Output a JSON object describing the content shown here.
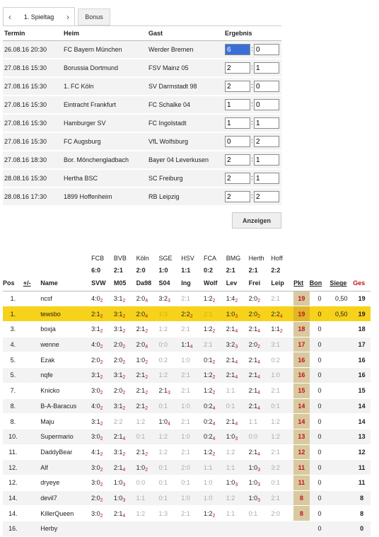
{
  "nav": {
    "prev_icon": "chevron-left-icon",
    "next_icon": "chevron-right-icon",
    "matchday_label": "1. Spieltag",
    "bonus_tab": "Bonus"
  },
  "fixtures": {
    "headers": {
      "date": "Termin",
      "home": "Heim",
      "guest": "Gast",
      "result": "Ergebnis"
    },
    "separator": ":",
    "rows": [
      {
        "date": "26.08.16 20:30",
        "home": "FC Bayern München",
        "guest": "Werder Bremen",
        "h": "6",
        "g": "0"
      },
      {
        "date": "27.08.16 15:30",
        "home": "Borussia Dortmund",
        "guest": "FSV Mainz 05",
        "h": "2",
        "g": "1"
      },
      {
        "date": "27.08.16 15:30",
        "home": "1. FC Köln",
        "guest": "SV Darmstadt 98",
        "h": "2",
        "g": "0"
      },
      {
        "date": "27.08.16 15:30",
        "home": "Eintracht Frankfurt",
        "guest": "FC Schalke 04",
        "h": "1",
        "g": "0"
      },
      {
        "date": "27.08.16 15:30",
        "home": "Hamburger SV",
        "guest": "FC Ingolstadt",
        "h": "1",
        "g": "1"
      },
      {
        "date": "27.08.16 15:30",
        "home": "FC Augsburg",
        "guest": "VfL Wolfsburg",
        "h": "0",
        "g": "2"
      },
      {
        "date": "27.08.16 18:30",
        "home": "Bor. Mönchengladbach",
        "guest": "Bayer 04 Leverkusen",
        "h": "2",
        "g": "1"
      },
      {
        "date": "28.08.16 15:30",
        "home": "Hertha BSC",
        "guest": "SC Freiburg",
        "h": "2",
        "g": "1"
      },
      {
        "date": "28.08.16 17:30",
        "home": "1899 Hoffenheim",
        "guest": "RB Leipzig",
        "h": "2",
        "g": "2"
      }
    ],
    "show_button": "Anzeigen"
  },
  "standings": {
    "game_headers": [
      "FCB",
      "BVB",
      "Köln",
      "SGE",
      "HSV",
      "FCA",
      "BMG",
      "Herth",
      "Hoff"
    ],
    "game_results": [
      "6:0",
      "2:1",
      "2:0",
      "1:0",
      "1:1",
      "0:2",
      "2:1",
      "2:1",
      "2:2"
    ],
    "guest_abbr": [
      "SVW",
      "M05",
      "Da98",
      "S04",
      "Ing",
      "Wolf",
      "Lev",
      "Frei",
      "Leip"
    ],
    "col_pos": "Pos",
    "col_pm": "+/-",
    "col_name": "Name",
    "col_pkt": "Pkt",
    "col_bon": "Bon",
    "col_sie": "Siege",
    "col_ges": "Ges",
    "rows": [
      {
        "pos": "1.",
        "name": "ncsf",
        "tips": [
          [
            "4:0",
            "2"
          ],
          [
            "3:1",
            "2"
          ],
          [
            "2:0",
            "4"
          ],
          [
            "3:2",
            "3"
          ],
          [
            "2:1",
            ""
          ],
          [
            "1:2",
            "2"
          ],
          [
            "1:4",
            "2"
          ],
          [
            "2:0",
            "2"
          ],
          [
            "2:1",
            ""
          ]
        ],
        "pkt": "19",
        "bon": "0",
        "sie": "0,50",
        "ges": "19"
      },
      {
        "pos": "1.",
        "name": "tewsbo",
        "tips": [
          [
            "2:1",
            "2"
          ],
          [
            "3:1",
            "2"
          ],
          [
            "2:0",
            "4"
          ],
          [
            "1:3",
            ""
          ],
          [
            "2:2",
            "2"
          ],
          [
            "2:1",
            ""
          ],
          [
            "1:0",
            "3"
          ],
          [
            "2:0",
            "2"
          ],
          [
            "2:2",
            "4"
          ]
        ],
        "pkt": "19",
        "bon": "0",
        "sie": "0,50",
        "ges": "19"
      },
      {
        "pos": "3.",
        "name": "boxja",
        "tips": [
          [
            "3:1",
            "2"
          ],
          [
            "3:1",
            "2"
          ],
          [
            "2:1",
            "2"
          ],
          [
            "1:2",
            ""
          ],
          [
            "2:1",
            ""
          ],
          [
            "1:2",
            "2"
          ],
          [
            "2:1",
            "4"
          ],
          [
            "2:1",
            "4"
          ],
          [
            "1:1",
            "2"
          ]
        ],
        "pkt": "18",
        "bon": "0",
        "sie": "",
        "ges": "18"
      },
      {
        "pos": "4.",
        "name": "wenne",
        "tips": [
          [
            "4:0",
            "2"
          ],
          [
            "2:0",
            "2"
          ],
          [
            "2:0",
            "4"
          ],
          [
            "0:0",
            ""
          ],
          [
            "1:1",
            "4"
          ],
          [
            "2:1",
            ""
          ],
          [
            "3:2",
            "3"
          ],
          [
            "2:0",
            "2"
          ],
          [
            "3:1",
            ""
          ]
        ],
        "pkt": "17",
        "bon": "0",
        "sie": "",
        "ges": "17"
      },
      {
        "pos": "5.",
        "name": "Ezak",
        "tips": [
          [
            "2:0",
            "2"
          ],
          [
            "2:0",
            "2"
          ],
          [
            "1:0",
            "2"
          ],
          [
            "0:2",
            ""
          ],
          [
            "1:0",
            ""
          ],
          [
            "0:1",
            "2"
          ],
          [
            "2:1",
            "4"
          ],
          [
            "2:1",
            "4"
          ],
          [
            "0:2",
            ""
          ]
        ],
        "pkt": "16",
        "bon": "0",
        "sie": "",
        "ges": "16"
      },
      {
        "pos": "5.",
        "name": "nqfe",
        "tips": [
          [
            "3:1",
            "2"
          ],
          [
            "3:1",
            "2"
          ],
          [
            "2:1",
            "2"
          ],
          [
            "1:2",
            ""
          ],
          [
            "2:1",
            ""
          ],
          [
            "1:2",
            "2"
          ],
          [
            "2:1",
            "4"
          ],
          [
            "2:1",
            "4"
          ],
          [
            "1:0",
            ""
          ]
        ],
        "pkt": "16",
        "bon": "0",
        "sie": "",
        "ges": "16"
      },
      {
        "pos": "7.",
        "name": "Knicko",
        "tips": [
          [
            "3:0",
            "2"
          ],
          [
            "2:0",
            "2"
          ],
          [
            "2:1",
            "2"
          ],
          [
            "2:1",
            "3"
          ],
          [
            "2:1",
            ""
          ],
          [
            "1:2",
            "2"
          ],
          [
            "1:1",
            ""
          ],
          [
            "2:1",
            "4"
          ],
          [
            "2:1",
            ""
          ]
        ],
        "pkt": "15",
        "bon": "0",
        "sie": "",
        "ges": "15"
      },
      {
        "pos": "8.",
        "name": "B-A-Baracus",
        "tips": [
          [
            "4:0",
            "2"
          ],
          [
            "3:1",
            "2"
          ],
          [
            "2:1",
            "2"
          ],
          [
            "0:1",
            ""
          ],
          [
            "1:0",
            ""
          ],
          [
            "0:2",
            "4"
          ],
          [
            "0:1",
            ""
          ],
          [
            "2:1",
            "4"
          ],
          [
            "0:1",
            ""
          ]
        ],
        "pkt": "14",
        "bon": "0",
        "sie": "",
        "ges": "14"
      },
      {
        "pos": "8.",
        "name": "Maju",
        "tips": [
          [
            "3:1",
            "2"
          ],
          [
            "2:2",
            ""
          ],
          [
            "1:2",
            ""
          ],
          [
            "1:0",
            "4"
          ],
          [
            "2:1",
            ""
          ],
          [
            "0:2",
            "4"
          ],
          [
            "2:1",
            "4"
          ],
          [
            "1:1",
            ""
          ],
          [
            "1:2",
            ""
          ]
        ],
        "pkt": "14",
        "bon": "0",
        "sie": "",
        "ges": "14"
      },
      {
        "pos": "10.",
        "name": "Supermario",
        "tips": [
          [
            "3:0",
            "2"
          ],
          [
            "2:1",
            "4"
          ],
          [
            "0:1",
            ""
          ],
          [
            "1:2",
            ""
          ],
          [
            "1:0",
            ""
          ],
          [
            "0:2",
            "4"
          ],
          [
            "1:0",
            "3"
          ],
          [
            "0:0",
            ""
          ],
          [
            "1:2",
            ""
          ]
        ],
        "pkt": "13",
        "bon": "0",
        "sie": "",
        "ges": "13"
      },
      {
        "pos": "11.",
        "name": "DaddyBear",
        "tips": [
          [
            "4:1",
            "2"
          ],
          [
            "3:1",
            "2"
          ],
          [
            "2:1",
            "2"
          ],
          [
            "1:2",
            ""
          ],
          [
            "2:1",
            ""
          ],
          [
            "1:2",
            "2"
          ],
          [
            "1:2",
            ""
          ],
          [
            "2:1",
            "4"
          ],
          [
            "2:1",
            ""
          ]
        ],
        "pkt": "12",
        "bon": "0",
        "sie": "",
        "ges": "12"
      },
      {
        "pos": "12.",
        "name": "Alf",
        "tips": [
          [
            "3:0",
            "2"
          ],
          [
            "2:1",
            "4"
          ],
          [
            "1:0",
            "2"
          ],
          [
            "0:1",
            ""
          ],
          [
            "2:0",
            ""
          ],
          [
            "1:1",
            ""
          ],
          [
            "1:1",
            ""
          ],
          [
            "1:0",
            "3"
          ],
          [
            "3:2",
            ""
          ]
        ],
        "pkt": "11",
        "bon": "0",
        "sie": "",
        "ges": "11"
      },
      {
        "pos": "12.",
        "name": "dryeye",
        "tips": [
          [
            "3:0",
            "2"
          ],
          [
            "1:0",
            "3"
          ],
          [
            "0:0",
            ""
          ],
          [
            "0:1",
            ""
          ],
          [
            "0:1",
            ""
          ],
          [
            "1:0",
            ""
          ],
          [
            "1:0",
            "3"
          ],
          [
            "1:0",
            "3"
          ],
          [
            "0:1",
            ""
          ]
        ],
        "pkt": "11",
        "bon": "0",
        "sie": "",
        "ges": "11"
      },
      {
        "pos": "14.",
        "name": "devil7",
        "tips": [
          [
            "2:0",
            "2"
          ],
          [
            "1:0",
            "3"
          ],
          [
            "1:1",
            ""
          ],
          [
            "0:1",
            ""
          ],
          [
            "1:0",
            ""
          ],
          [
            "1:0",
            ""
          ],
          [
            "1:2",
            ""
          ],
          [
            "1:0",
            "3"
          ],
          [
            "2:1",
            ""
          ]
        ],
        "pkt": "8",
        "bon": "0",
        "sie": "",
        "ges": "8"
      },
      {
        "pos": "14.",
        "name": "KillerQueen",
        "tips": [
          [
            "3:0",
            "2"
          ],
          [
            "2:1",
            "4"
          ],
          [
            "1:2",
            ""
          ],
          [
            "1:3",
            ""
          ],
          [
            "2:1",
            ""
          ],
          [
            "1:2",
            "2"
          ],
          [
            "1:1",
            ""
          ],
          [
            "0:1",
            ""
          ],
          [
            "2:0",
            ""
          ]
        ],
        "pkt": "8",
        "bon": "0",
        "sie": "",
        "ges": "8"
      },
      {
        "pos": "16.",
        "name": "Herby",
        "tips": [
          [
            "",
            ""
          ],
          [
            "",
            ""
          ],
          [
            "",
            ""
          ],
          [
            "",
            ""
          ],
          [
            "",
            ""
          ],
          [
            "",
            ""
          ],
          [
            "",
            ""
          ],
          [
            "",
            ""
          ],
          [
            "",
            ""
          ]
        ],
        "pkt": "",
        "bon": "0",
        "sie": "",
        "ges": "0"
      }
    ]
  },
  "colors": {
    "highlight_row": "#f7d21a",
    "points": "#c0141d",
    "input_focus": "#3a6fd8"
  }
}
